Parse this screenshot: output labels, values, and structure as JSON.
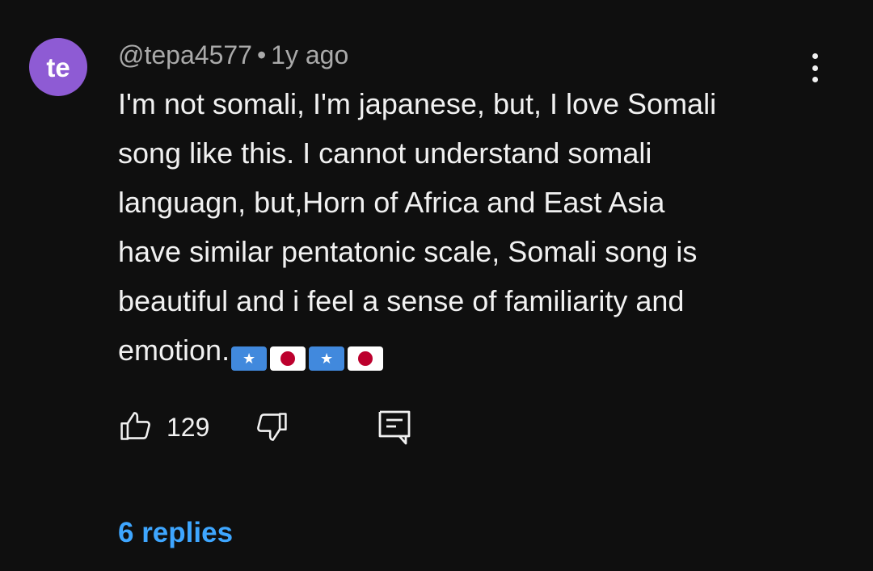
{
  "comment": {
    "avatar_initials": "te",
    "avatar_color": "#8e5bd4",
    "author": "@tepa4577",
    "separator": "•",
    "time_ago": "1y ago",
    "text": "I'm not somali, I'm japanese, but, I love Somali\nsong like this. I cannot understand somali\nlanguagn, but,Horn of Africa and East Asia\nhave similar pentatonic scale, Somali song is\nbeautiful and i feel a sense of familiarity and\nemotion.",
    "flags": [
      "somalia-flag",
      "japan-flag",
      "somalia-flag",
      "japan-flag"
    ],
    "like_count": "129",
    "replies_label": "6 replies",
    "replies_color": "#3ea6ff"
  },
  "icons": {
    "like": "thumbs-up-icon",
    "dislike": "thumbs-down-icon",
    "reply": "reply-comment-icon",
    "menu": "more-vert-icon"
  }
}
